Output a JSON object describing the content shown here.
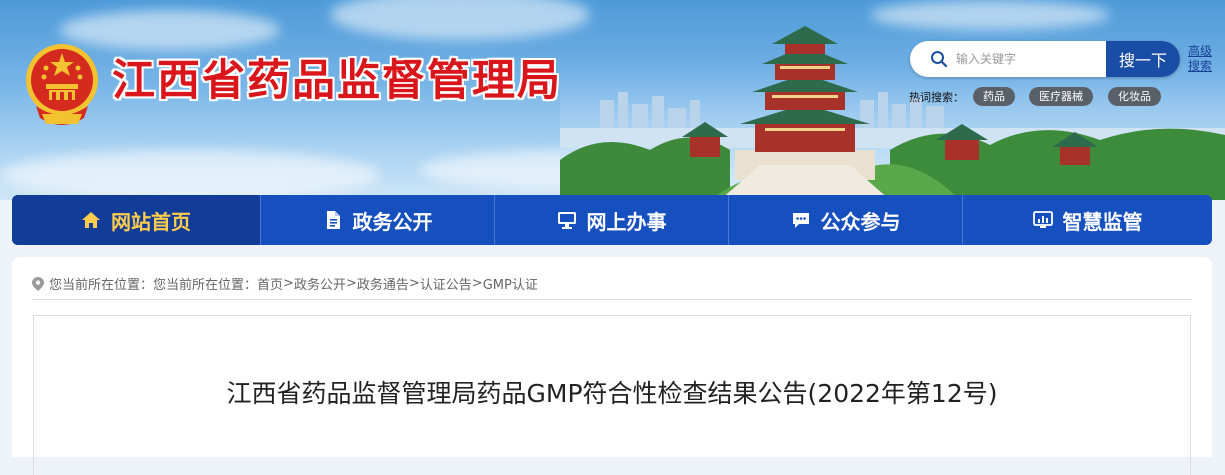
{
  "header": {
    "site_title": "江西省药品监督管理局",
    "search": {
      "placeholder": "输入关键字",
      "button_label": "搜一下",
      "advanced_label": "高级搜索"
    },
    "hot_search": {
      "label": "热词搜索：",
      "tags": [
        "药品",
        "医疗器械",
        "化妆品"
      ]
    }
  },
  "nav": {
    "items": [
      {
        "label": "网站首页",
        "icon": "home-icon",
        "active": true
      },
      {
        "label": "政务公开",
        "icon": "document-icon",
        "active": false
      },
      {
        "label": "网上办事",
        "icon": "monitor-icon",
        "active": false
      },
      {
        "label": "公众参与",
        "icon": "chat-icon",
        "active": false
      },
      {
        "label": "智慧监管",
        "icon": "dashboard-icon",
        "active": false
      }
    ]
  },
  "breadcrumb": {
    "prefix": "您当前所在位置：您当前所在位置：",
    "items": [
      "首页",
      "政务公开",
      "政务通告",
      "认证公告",
      "GMP认证"
    ],
    "separator": ">"
  },
  "article": {
    "title": "江西省药品监督管理局药品GMP符合性检查结果公告(2022年第12号)"
  },
  "colors": {
    "brand_red": "#d9161b",
    "nav_blue": "#1650bf",
    "nav_active": "#113c97",
    "nav_active_text": "#ffcc4d",
    "search_button": "#1a4ea6"
  }
}
